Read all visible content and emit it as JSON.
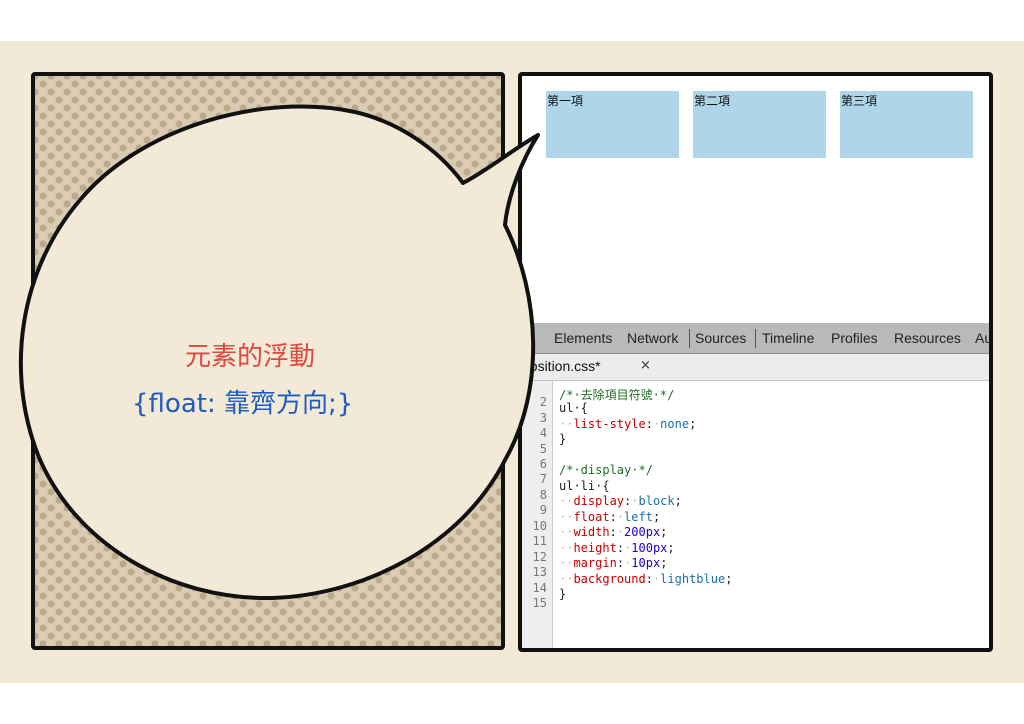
{
  "preview": {
    "items": [
      {
        "label": "第一項"
      },
      {
        "label": "第二項"
      },
      {
        "label": "第三項"
      }
    ],
    "item_color": "#aed5e8"
  },
  "devtools": {
    "tabs": [
      "Elements",
      "Network",
      "Sources",
      "Timeline",
      "Profiles",
      "Resources",
      "Au"
    ],
    "active_tab": "Sources",
    "file_tab": {
      "name": "position.css*",
      "close": "×"
    },
    "line_numbers": [
      "2",
      "3",
      "4",
      "5",
      "6",
      "7",
      "8",
      "9",
      "10",
      "11",
      "12",
      "13",
      "14",
      "15"
    ],
    "code": {
      "l1_comment": "/*·去除項目符號·*/",
      "l2_selector": "ul·{",
      "l3_prop": "list-style",
      "l3_val": "none",
      "l4_close": "}",
      "l6_comment": "/*·display·*/",
      "l7_selector": "ul·li·{",
      "l8_prop": "display",
      "l8_val": "block",
      "l9_prop": "float",
      "l9_val": "left",
      "l10_prop": "width",
      "l10_val": "200px",
      "l11_prop": "height",
      "l11_val": "100px",
      "l12_prop": "margin",
      "l12_val": "10px",
      "l13_prop": "background",
      "l13_val": "lightblue",
      "l14_close": "}"
    }
  },
  "bubble": {
    "title": "元素的浮動",
    "code": "{float: 靠齊方向;}",
    "title_color": "#e2473d",
    "code_color": "#1f5bc5"
  }
}
